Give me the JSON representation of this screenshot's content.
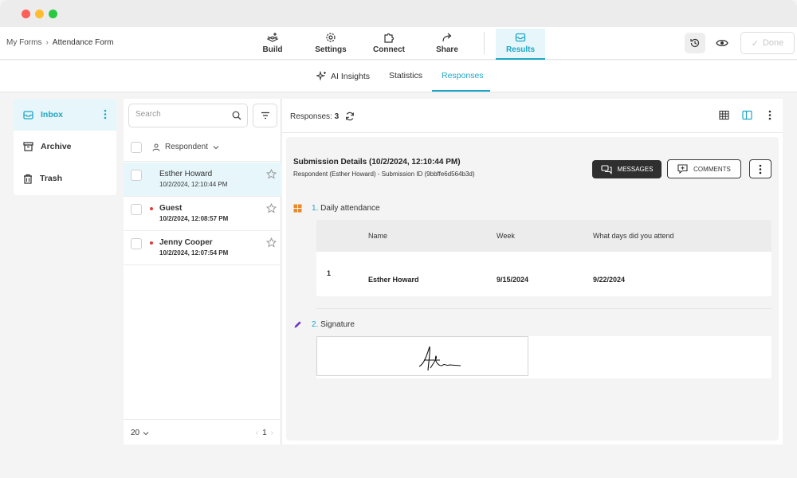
{
  "breadcrumb": {
    "root": "My Forms",
    "separator": "›",
    "current": "Attendance Form"
  },
  "top_nav": {
    "build": "Build",
    "settings": "Settings",
    "connect": "Connect",
    "share": "Share",
    "results": "Results",
    "done": "Done"
  },
  "sub_tabs": {
    "ai_insights": "AI Insights",
    "statistics": "Statistics",
    "responses": "Responses"
  },
  "sidebar": {
    "inbox": "Inbox",
    "archive": "Archive",
    "trash": "Trash"
  },
  "list": {
    "search_placeholder": "Search",
    "header": "Respondent",
    "rows": [
      {
        "name": "Esther Howard",
        "date": "10/2/2024, 12:10:44 PM",
        "unread": false
      },
      {
        "name": "Guest",
        "date": "10/2/2024, 12:08:57 PM",
        "unread": true
      },
      {
        "name": "Jenny Cooper",
        "date": "10/2/2024, 12:07:54 PM",
        "unread": true
      }
    ],
    "page_size": "20",
    "page": "1"
  },
  "main": {
    "responses_label": "Responses:",
    "responses_count": "3"
  },
  "submission": {
    "title": "Submission Details (10/2/2024, 12:10:44 PM)",
    "meta": "Respondent (Esther Howard) - Submission ID (9bbffe6d564b3d)",
    "messages": "MESSAGES",
    "comments": "COMMENTS"
  },
  "questions": {
    "q1": {
      "num": "1.",
      "label": "Daily attendance"
    },
    "q2": {
      "num": "2.",
      "label": "Signature"
    }
  },
  "table": {
    "columns": [
      "Name",
      "Week",
      "What days did you attend"
    ],
    "rows": [
      {
        "index": "1",
        "cells": [
          "Esther Howard",
          "9/15/2024",
          "9/22/2024"
        ]
      }
    ]
  },
  "colors": {
    "accent": "#1ea7c5",
    "unread": "#e23b3b",
    "dark_button": "#2f2f2f"
  }
}
